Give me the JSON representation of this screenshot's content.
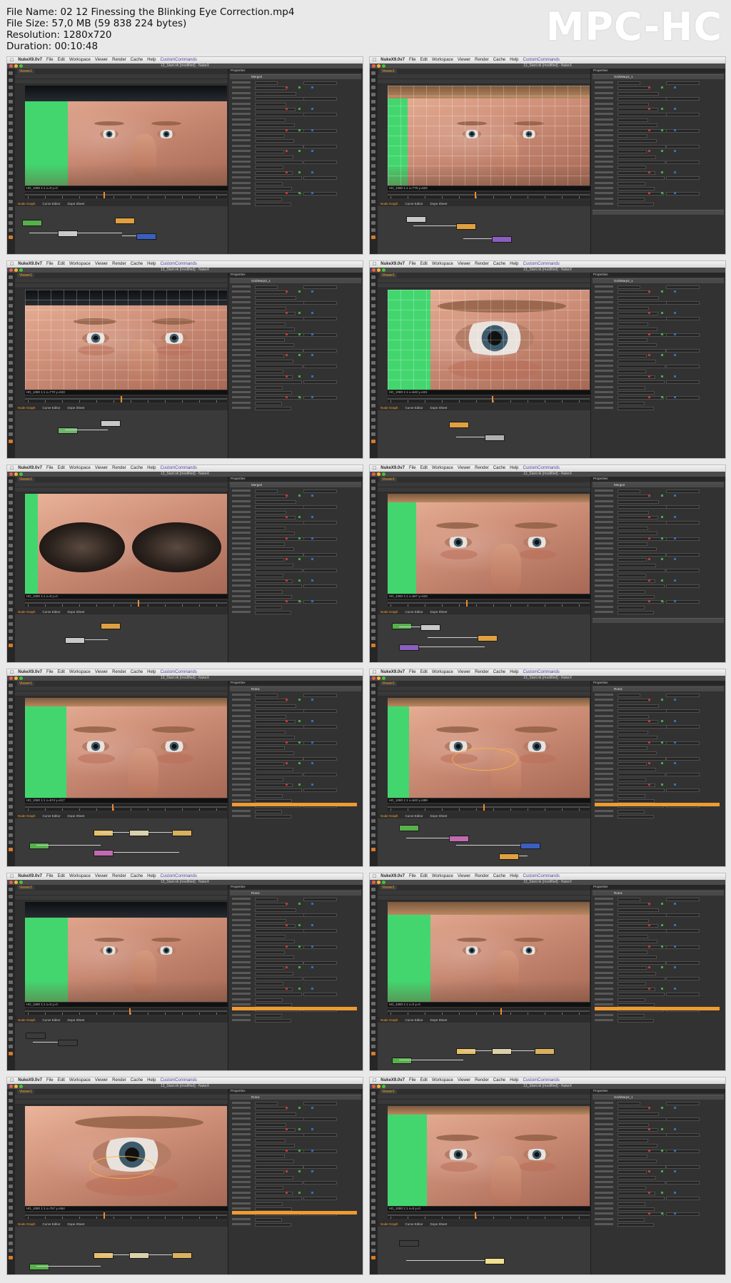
{
  "file_info": {
    "file_name": "File Name: 02 12 Finessing the Blinking Eye Correction.mp4",
    "file_size": "File Size: 57,0 MB (59 838 224 bytes)",
    "resolution": "Resolution: 1280x720",
    "duration": "Duration: 00:10:48"
  },
  "logo": "MPC-HC",
  "menubar": {
    "app": "NukeX9.0v7",
    "items": [
      "File",
      "Edit",
      "Workspace",
      "Viewer",
      "Render",
      "Cache",
      "Help"
    ],
    "custom": "CustomCommands"
  },
  "window_title": "13_Start.nk [modified] - NukeX",
  "viewer_tab": "Viewer1",
  "node_graph_tabs": [
    "Node Graph",
    "Curve Editor",
    "Dope Sheet"
  ],
  "properties_title": "Properties",
  "thumbnails": [
    {
      "infobar": "HD_1080 1:1 x=0 y=0",
      "props": "Merge2"
    },
    {
      "infobar": "HD_1080 1:1 x=770 y=622",
      "props": "GridWarp3_1"
    },
    {
      "infobar": "HD_1080 1:1 x=770 y=633",
      "props": "GridWarp3_1"
    },
    {
      "infobar": "HD_1080 1:1 x=640 y=621",
      "props": "GridWarp3_1"
    },
    {
      "infobar": "HD_1080 1:1 x=0 y=0",
      "props": "Merge2"
    },
    {
      "infobar": "HD_1080 1:1 x=667 y=633",
      "props": "Merge2"
    },
    {
      "infobar": "HD_1080 1:1 x=674 y=617",
      "props": "Roto1"
    },
    {
      "infobar": "HD_1080 1:1 x=640 y=599",
      "props": "Roto1"
    },
    {
      "infobar": "HD_1080 1:1 x=0 y=0",
      "props": "Roto1"
    },
    {
      "infobar": "HD_1080 1:1 x=0 y=0",
      "props": "Roto1"
    },
    {
      "infobar": "HD_1080 1:1 x=757 y=554",
      "props": "Roto1"
    },
    {
      "infobar": "HD_1080 1:1 x=0 y=0",
      "props": "GridWarp3_1"
    }
  ],
  "colors": {
    "green_screen": "#43d66f",
    "nuke_orange": "#f09a32",
    "ui_dark": "#2b2b2b"
  }
}
